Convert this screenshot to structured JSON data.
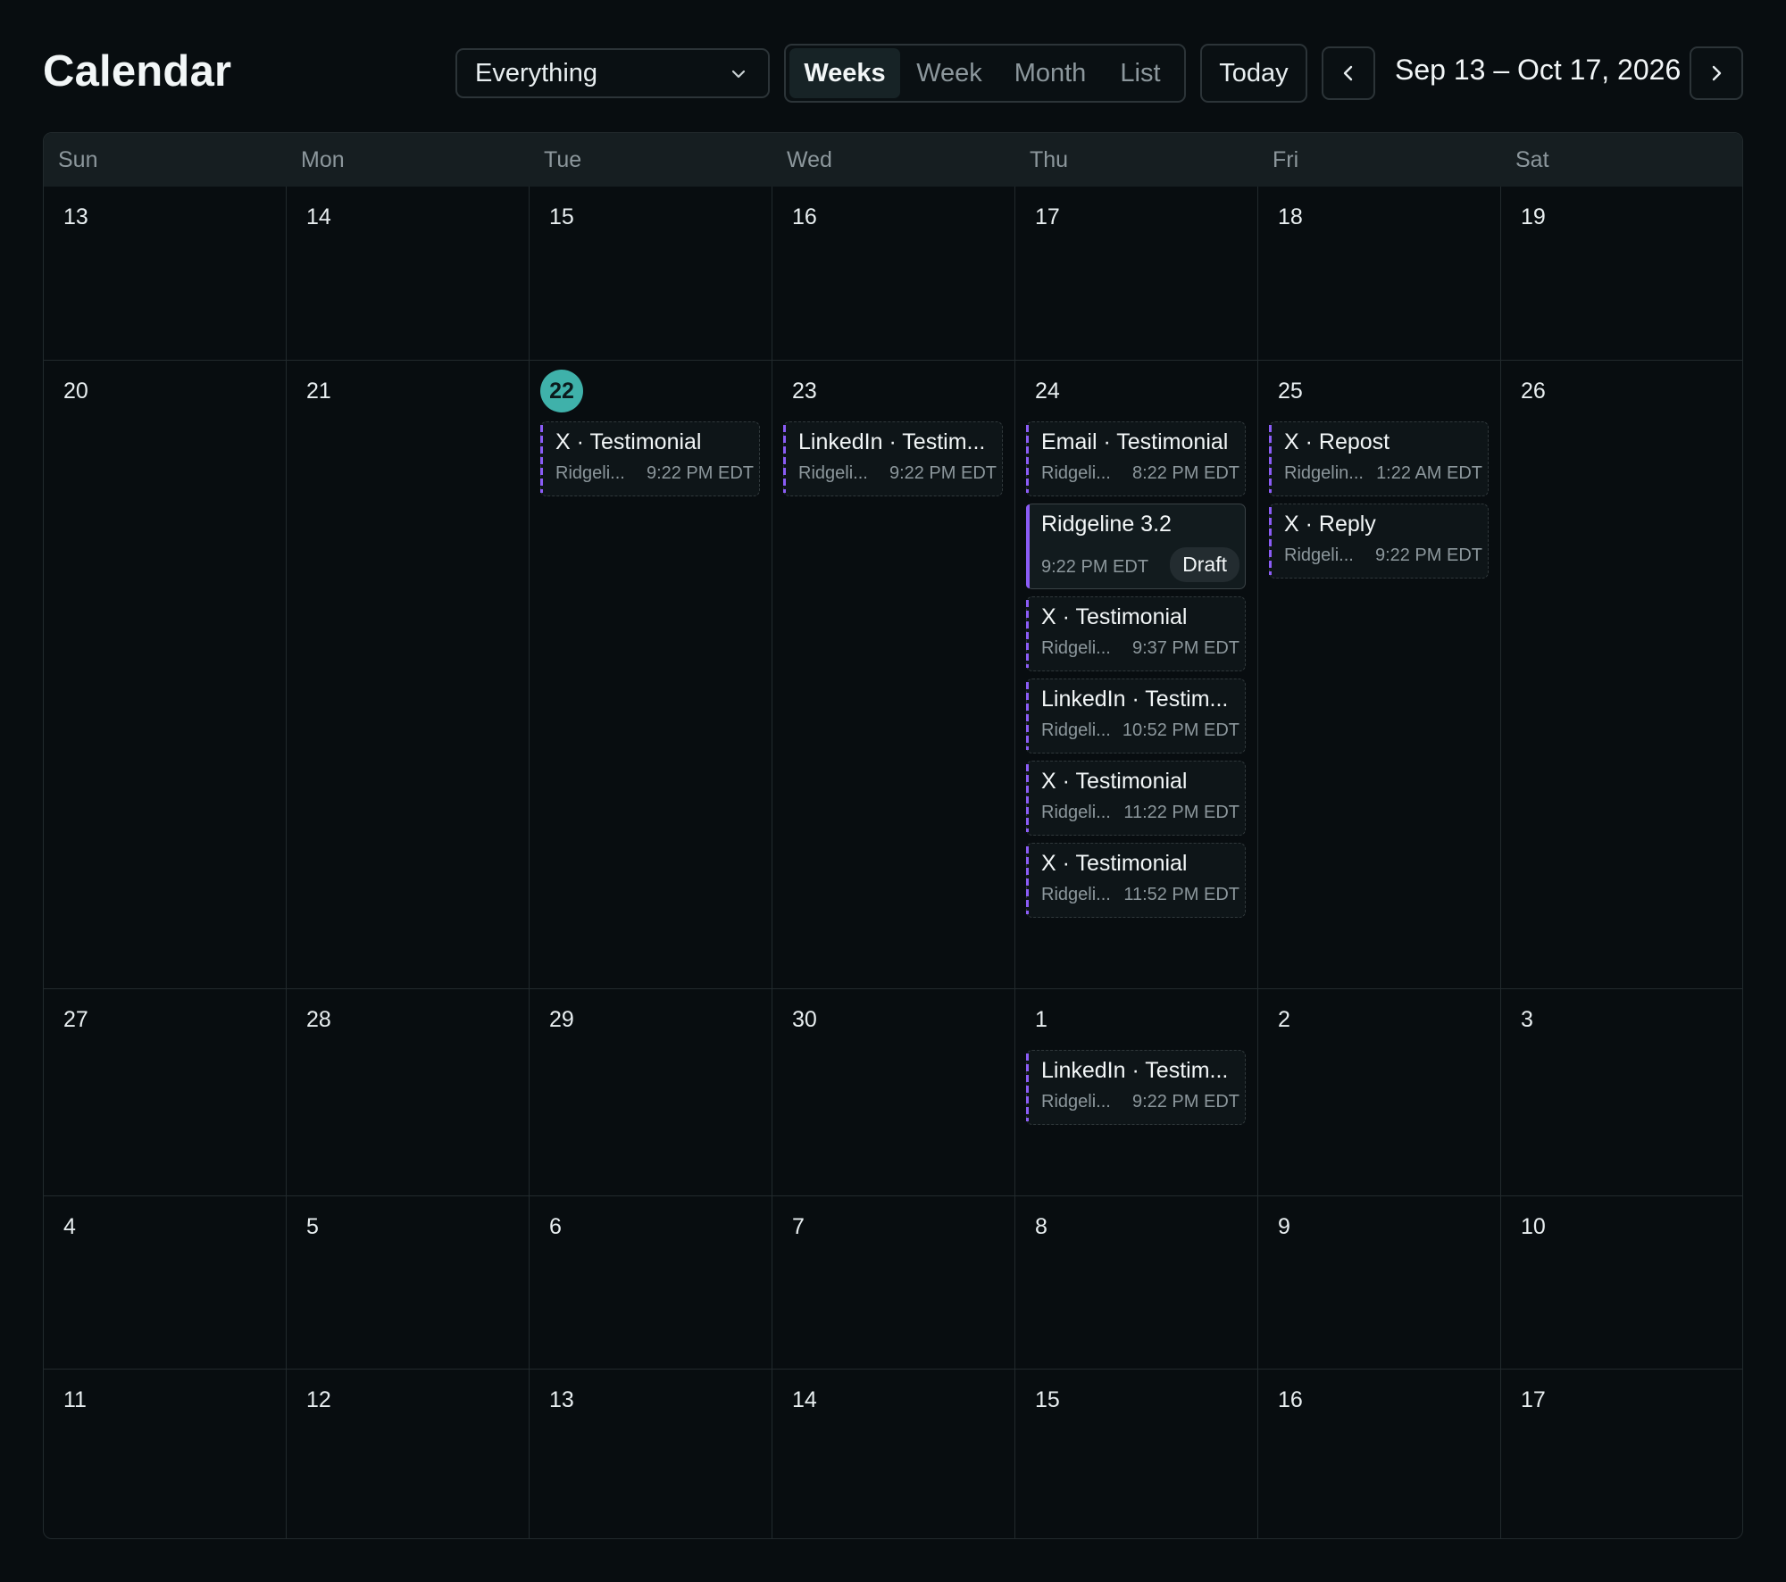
{
  "header": {
    "title": "Calendar",
    "filter": {
      "value": "Everything"
    },
    "views": [
      {
        "label": "Weeks",
        "active": true
      },
      {
        "label": "Week",
        "active": false
      },
      {
        "label": "Month",
        "active": false
      },
      {
        "label": "List",
        "active": false
      }
    ],
    "today_label": "Today",
    "range_label": "Sep 13 – Oct 17, 2026"
  },
  "calendar": {
    "days_of_week": [
      "Sun",
      "Mon",
      "Tue",
      "Wed",
      "Thu",
      "Fri",
      "Sat"
    ],
    "weeks": [
      {
        "days": [
          {
            "num": "13"
          },
          {
            "num": "14"
          },
          {
            "num": "15"
          },
          {
            "num": "16"
          },
          {
            "num": "17"
          },
          {
            "num": "18"
          },
          {
            "num": "19"
          }
        ]
      },
      {
        "days": [
          {
            "num": "20"
          },
          {
            "num": "21"
          },
          {
            "num": "22",
            "today": true,
            "events": [
              {
                "title": "X · Testimonial",
                "sub": "Ridgeli...",
                "time": "9:22 PM EDT"
              }
            ]
          },
          {
            "num": "23",
            "events": [
              {
                "title": "LinkedIn · Testim...",
                "sub": "Ridgeli...",
                "time": "9:22 PM EDT"
              }
            ]
          },
          {
            "num": "24",
            "events": [
              {
                "title": "Email · Testimonial",
                "sub": "Ridgeli...",
                "time": "8:22 PM EDT"
              },
              {
                "title": "Ridgeline 3.2",
                "time": "9:22 PM EDT",
                "badge": "Draft",
                "solid": true
              },
              {
                "title": "X · Testimonial",
                "sub": "Ridgeli...",
                "time": "9:37 PM EDT"
              },
              {
                "title": "LinkedIn · Testim...",
                "sub": "Ridgeli...",
                "time": "10:52 PM EDT"
              },
              {
                "title": "X · Testimonial",
                "sub": "Ridgeli...",
                "time": "11:22 PM EDT"
              },
              {
                "title": "X · Testimonial",
                "sub": "Ridgeli...",
                "time": "11:52 PM EDT"
              }
            ]
          },
          {
            "num": "25",
            "events": [
              {
                "title": "X · Repost",
                "sub": "Ridgelin...",
                "time": "1:22 AM EDT"
              },
              {
                "title": "X · Reply",
                "sub": "Ridgeli...",
                "time": "9:22 PM EDT"
              }
            ]
          },
          {
            "num": "26"
          }
        ]
      },
      {
        "days": [
          {
            "num": "27"
          },
          {
            "num": "28"
          },
          {
            "num": "29"
          },
          {
            "num": "30"
          },
          {
            "num": "1",
            "events": [
              {
                "title": "LinkedIn · Testim...",
                "sub": "Ridgeli...",
                "time": "9:22 PM EDT"
              }
            ]
          },
          {
            "num": "2"
          },
          {
            "num": "3"
          }
        ]
      },
      {
        "days": [
          {
            "num": "4"
          },
          {
            "num": "5"
          },
          {
            "num": "6"
          },
          {
            "num": "7"
          },
          {
            "num": "8"
          },
          {
            "num": "9"
          },
          {
            "num": "10"
          }
        ]
      },
      {
        "days": [
          {
            "num": "11"
          },
          {
            "num": "12"
          },
          {
            "num": "13"
          },
          {
            "num": "14"
          },
          {
            "num": "15"
          },
          {
            "num": "16"
          },
          {
            "num": "17"
          }
        ]
      }
    ]
  },
  "colors": {
    "accent": "#8b5cf6",
    "today": "#3fb1aa",
    "background": "#080d10"
  },
  "icons": {
    "filter": "chevron-down-icon",
    "prev": "chevron-left-icon",
    "next": "chevron-right-icon"
  }
}
